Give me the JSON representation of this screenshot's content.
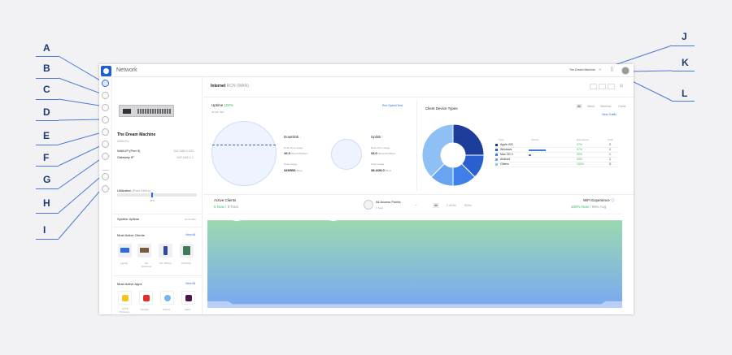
{
  "callouts": [
    "A",
    "B",
    "C",
    "D",
    "E",
    "F",
    "G",
    "H",
    "I",
    "J",
    "K",
    "L"
  ],
  "app": {
    "title": "Network",
    "site_label": "",
    "site_name": "The Dream Machine",
    "user_avatar": "avatar"
  },
  "device": {
    "name": "The Dream Machine",
    "model": "UDM-Pro",
    "wan_ip_label": "WAN IP (Port 9)",
    "wan_ip_value": "192.168.0.232",
    "gateway_ip_label": "Gateway IP",
    "gateway_ip_value": "192.168.1.1",
    "utilization_label": "Utilization",
    "utilization_period": "(Past 24Hrs)",
    "utilization_fraction": 0.43,
    "utilization_marker": "44%"
  },
  "system_uptime": {
    "label": "System Uptime",
    "value": "3d 4h 46m"
  },
  "most_active_clients": {
    "title": "Most Active Clients",
    "view_all": "View All",
    "items": [
      {
        "label": "Laptop",
        "icon": "laptop-icon"
      },
      {
        "label": "My Macbook",
        "icon": "macbook-icon"
      },
      {
        "label": "Ms. iPhone",
        "icon": "phone-icon"
      },
      {
        "label": "Old iPad",
        "icon": "tablet-icon"
      }
    ]
  },
  "most_active_apps": {
    "title": "Most Active Apps",
    "view_all": "View All",
    "items": [
      {
        "label": "HTTP Protocol...",
        "icon": "lock-icon",
        "color": "#f5c518"
      },
      {
        "label": "Youtube",
        "icon": "youtube-icon",
        "color": "#e52d27"
      },
      {
        "label": "iCloud",
        "icon": "cloud-icon",
        "color": "#6fb6f2"
      },
      {
        "label": "Slack",
        "icon": "slack-icon",
        "color": "#4a154b"
      }
    ]
  },
  "internet": {
    "title": "Internet",
    "subtitle": "RCN (WAN)",
    "uptime_label": "Uptime",
    "uptime_value": "100%",
    "uptime_sub": "3d 21h 49m",
    "speed_test": "Run Speed Test",
    "downlink": {
      "label": "Downlink",
      "arrow": "↓",
      "rt_label": "Real-Time Usage",
      "rt_value": "16.3",
      "rt_unit": "Mbps/553Mbps",
      "peak_label": "Peak Usage",
      "peak_value": "345/553",
      "peak_unit": "Mbps"
    },
    "uplink": {
      "label": "Uplink",
      "arrow": "↑",
      "rt_label": "Real-Time Usage",
      "rt_value": "33.0",
      "rt_unit": "Mbps/28.0Mbps",
      "peak_label": "Peak Usage",
      "peak_value": "38.4/28.0",
      "peak_unit": "Mbps"
    }
  },
  "client_device_types": {
    "title": "Client Device Types",
    "tabs": [
      "All",
      "Wired",
      "Wireless",
      "Guest"
    ],
    "selected_tab": "All",
    "view_traffic": "View Traffic",
    "columns": [
      "Type",
      "Activity",
      "Experience",
      "Total"
    ],
    "rows": [
      {
        "type": "Apple iOS",
        "activity": 0,
        "experience": "97%",
        "total": "2",
        "color": "#1c3d99"
      },
      {
        "type": "Windows",
        "activity": 0.65,
        "experience": "97%",
        "total": "1",
        "color": "#2a5fcf"
      },
      {
        "type": "Mac OS X",
        "activity": 0.1,
        "experience": "99%",
        "total": "1",
        "color": "#3f7fe8"
      },
      {
        "type": "Android",
        "activity": 0,
        "experience": "99%",
        "total": "1",
        "color": "#6aa4f0"
      },
      {
        "type": "Others",
        "activity": 0,
        "experience": "100%",
        "total": "3",
        "color": "#8ec0f5"
      }
    ]
  },
  "active_clients": {
    "title": "Active Clients",
    "now": "5 Now",
    "sep": "/",
    "total": "8 Total",
    "access_points_label": "All Access Points",
    "access_points_sub": "1 Total",
    "bands": [
      "All",
      "2.4GHz",
      "5GHz"
    ],
    "selected_band": "All",
    "wifi_title": "WiFi Experience",
    "wifi_now": "100% Now",
    "wifi_sep": "/",
    "wifi_avg": "99% Avg"
  },
  "chart_data": {
    "type": "area",
    "title": "",
    "series": [
      {
        "name": "",
        "values": [
          93,
          93,
          93,
          93,
          93,
          93,
          93,
          92,
          93,
          93,
          93,
          93,
          93,
          93,
          93,
          93,
          93,
          93,
          93,
          93,
          93,
          93,
          93,
          93,
          93,
          93,
          93,
          93,
          93,
          93,
          92,
          93,
          93,
          93,
          93,
          93,
          93,
          93,
          93,
          93,
          93,
          93,
          93,
          93,
          93,
          93,
          93,
          93,
          93,
          93,
          93,
          93,
          93,
          93,
          93,
          93,
          93,
          93,
          93,
          93,
          93,
          93,
          93,
          93,
          93,
          93,
          93,
          93,
          93,
          93,
          93,
          93,
          93,
          93,
          93,
          93,
          93,
          93,
          93,
          93,
          93,
          93,
          93,
          93,
          93,
          93,
          93,
          93,
          93,
          93,
          93,
          93,
          93,
          93,
          93,
          93,
          93,
          93,
          93,
          93
        ]
      },
      {
        "name": "",
        "values": [
          7,
          7,
          7,
          7,
          7,
          7,
          4,
          4,
          4,
          4,
          4,
          4,
          4,
          4,
          4,
          4,
          4,
          4,
          4,
          4,
          4,
          4,
          4,
          4,
          4,
          4,
          4,
          4,
          4,
          4,
          4,
          4,
          4,
          4,
          4,
          4,
          4,
          4,
          4,
          4,
          4,
          4,
          4,
          4,
          4,
          4,
          4,
          4,
          4,
          4,
          4,
          4,
          4,
          4,
          4,
          4,
          4,
          4,
          4,
          4,
          4,
          4,
          4,
          4,
          4,
          4,
          4,
          4,
          4,
          4,
          4,
          4,
          4,
          4,
          4,
          4,
          4,
          4,
          4,
          4,
          4,
          4,
          4,
          4,
          4,
          4,
          4,
          4,
          4,
          4,
          4,
          4,
          4,
          4,
          4,
          7,
          7,
          7,
          7,
          7
        ]
      }
    ],
    "ylim": [
      0,
      100
    ],
    "colors": [
      "#8fd5a8",
      "#6b9ef0"
    ]
  }
}
